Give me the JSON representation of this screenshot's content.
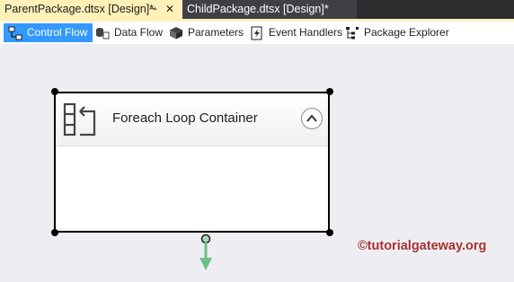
{
  "tabs": {
    "active_label": "ParentPackage.dtsx [Design]*",
    "pin_glyph": "⊸",
    "close_glyph": "✕",
    "inactive_label": "ChildPackage.dtsx [Design]*"
  },
  "designer_tabs": [
    {
      "label": "Control Flow",
      "icon": "control-flow-icon",
      "selected": true
    },
    {
      "label": "Data Flow",
      "icon": "data-flow-icon",
      "selected": false
    },
    {
      "label": "Parameters",
      "icon": "parameters-icon",
      "selected": false
    },
    {
      "label": "Event Handlers",
      "icon": "event-handlers-icon",
      "selected": false
    },
    {
      "label": "Package Explorer",
      "icon": "package-explorer-icon",
      "selected": false
    }
  ],
  "canvas": {
    "container_title": "Foreach Loop Container",
    "container_icon": "foreach-loop-icon",
    "collapse_icon": "chevron-up-icon"
  },
  "watermark": "©tutorialgateway.org",
  "colors": {
    "active_tab": "#fff1b8",
    "selected_subtab": "#3399ff",
    "connector": "#6cc08a",
    "watermark": "#a83232"
  }
}
